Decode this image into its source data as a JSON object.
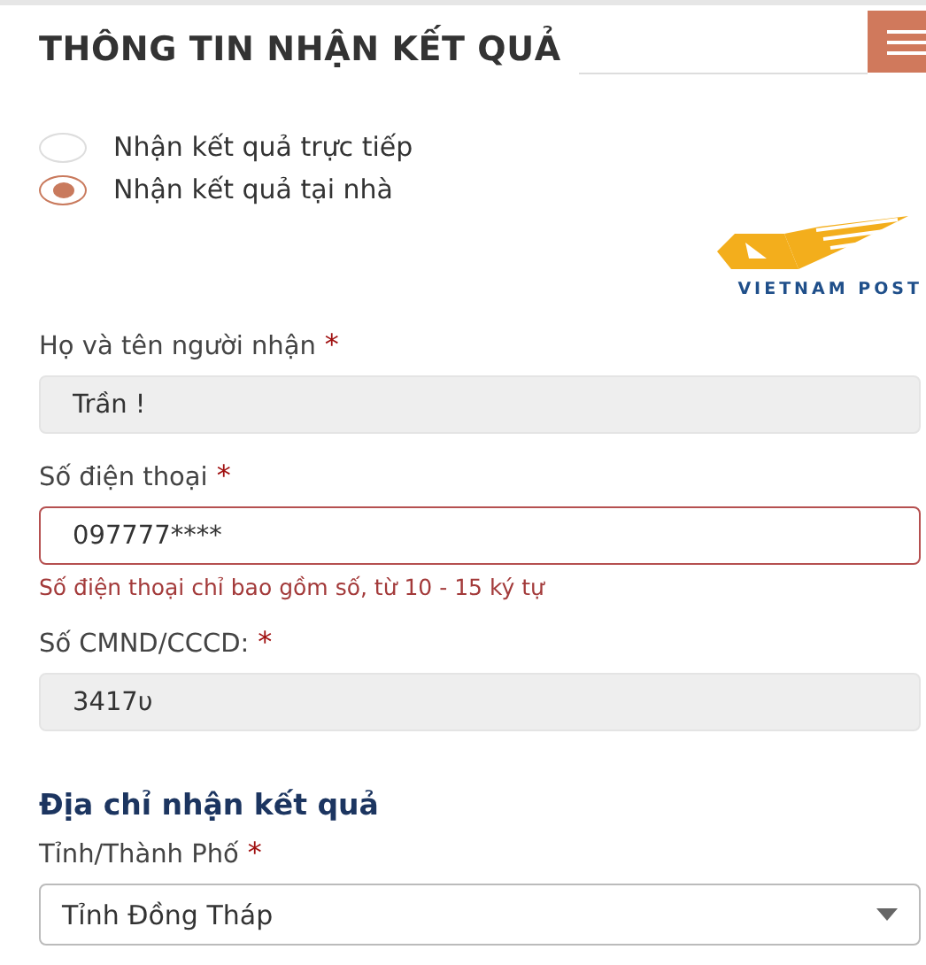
{
  "header": {
    "title": "THÔNG TIN NHẬN KẾT QUẢ"
  },
  "delivery_options": [
    {
      "label": "Nhận kết quả trực tiếp",
      "selected": false
    },
    {
      "label": "Nhận kết quả tại nhà",
      "selected": true
    }
  ],
  "logo": {
    "text": "VIETNAM POST"
  },
  "fields": [
    {
      "kind": "text",
      "label": "Họ và tên người nhận",
      "required_mark": "*",
      "value": "Trần !",
      "disabled": true
    },
    {
      "kind": "text",
      "label": "Số điện thoại",
      "required_mark": "*",
      "value": "097777****",
      "disabled": false,
      "error": "Số điện thoại chỉ bao gồm số, từ 10 - 15 ký tự"
    },
    {
      "kind": "text",
      "label": "Số CMND/CCCD:",
      "required_mark": "*",
      "value": "3417υ",
      "disabled": true
    }
  ],
  "address_section": {
    "title": "Địa chỉ nhận kết quả",
    "fields": [
      {
        "kind": "select",
        "label": "Tỉnh/Thành Phố",
        "required_mark": "*",
        "value": "Tỉnh Đồng Tháp"
      }
    ]
  }
}
